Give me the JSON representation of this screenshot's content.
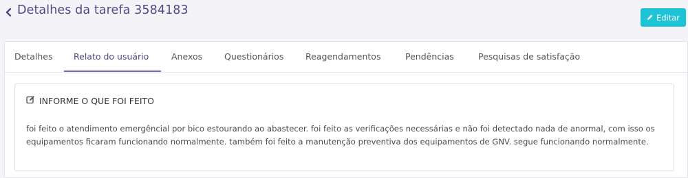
{
  "header": {
    "title": "Detalhes da tarefa 3584183",
    "edit_label": "Editar"
  },
  "tabs": [
    {
      "label": "Detalhes"
    },
    {
      "label": "Relato do usuário"
    },
    {
      "label": "Anexos"
    },
    {
      "label": "Questionários"
    },
    {
      "label": "Reagendamentos"
    },
    {
      "label": "Pendências"
    },
    {
      "label": "Pesquisas de satisfação"
    }
  ],
  "active_tab": "Relato do usuário",
  "report": {
    "heading": "INFORME O QUE FOI FEITO",
    "text": "foi feito o atendimento emergêncial por bico estourando ao abastecer. foi feito as verificações necessárias e não foi detectado nada de anormal, com isso os equipamentos ficaram funcionando normalmente. também foi feito a manutenção preventiva dos equipamentos de GNV. segue funcionando normalmente."
  },
  "colors": {
    "title": "#4d4a85",
    "accent_button": "#1fc3d6",
    "tab_underline": "#6e6ab0"
  },
  "icons": {
    "back": "chevron-left-icon",
    "edit": "pencil-icon",
    "heading": "edit-square-icon"
  }
}
